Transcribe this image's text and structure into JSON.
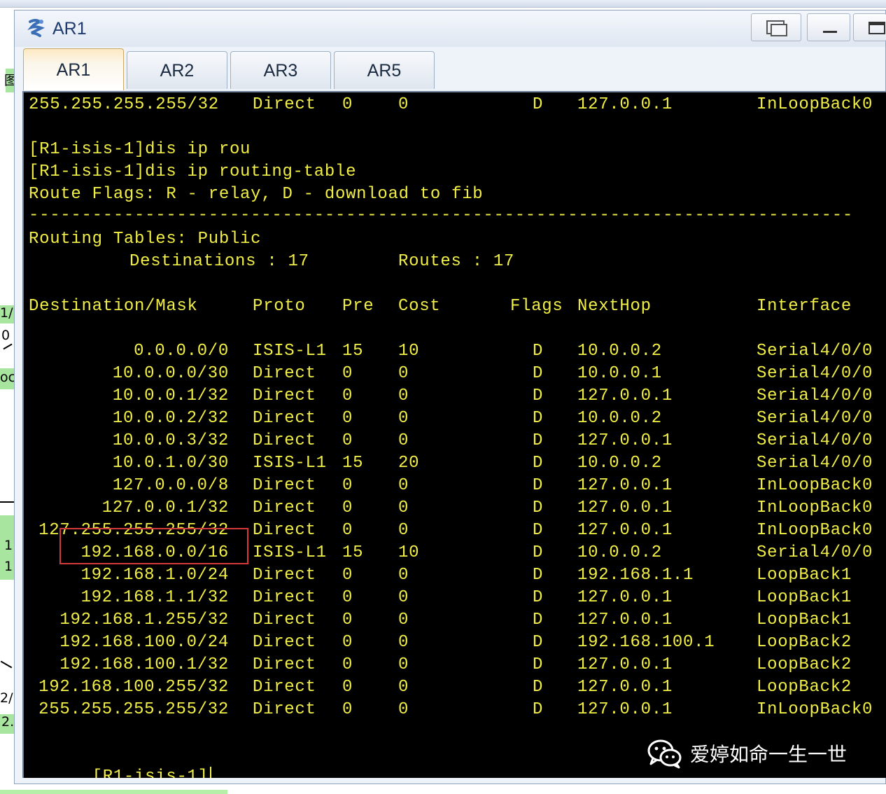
{
  "window": {
    "title": "AR1",
    "tabs": [
      {
        "label": "AR1",
        "active": true
      },
      {
        "label": "AR2",
        "active": false
      },
      {
        "label": "AR3",
        "active": false
      },
      {
        "label": "AR5",
        "active": false
      }
    ]
  },
  "console": {
    "prev_line": {
      "dest": "255.255.255.255/32",
      "proto": "Direct",
      "pre": "0",
      "cost": "0",
      "flags": "D",
      "nexthop": "127.0.0.1",
      "iface": "InLoopBack0"
    },
    "cmd1": "[R1-isis-1]dis ip rou",
    "cmd2": "[R1-isis-1]dis ip routing-table",
    "route_flags": "Route Flags: R - relay, D - download to fib",
    "separator": "------------------------------------------------------------------------------",
    "tables_line": "Routing Tables: Public",
    "destinations_line": "Destinations : 17",
    "routes_line": "Routes : 17",
    "headers": {
      "dest": "Destination/Mask",
      "proto": "Proto",
      "pre": "Pre",
      "cost": "Cost",
      "flags": "Flags",
      "nexthop": "NextHop",
      "iface": "Interface"
    },
    "rows": [
      {
        "dest": "0.0.0.0/0",
        "proto": "ISIS-L1",
        "pre": "15",
        "cost": "10",
        "flags": "D",
        "nexthop": "10.0.0.2",
        "iface": "Serial4/0/0"
      },
      {
        "dest": "10.0.0.0/30",
        "proto": "Direct",
        "pre": "0",
        "cost": "0",
        "flags": "D",
        "nexthop": "10.0.0.1",
        "iface": "Serial4/0/0"
      },
      {
        "dest": "10.0.0.1/32",
        "proto": "Direct",
        "pre": "0",
        "cost": "0",
        "flags": "D",
        "nexthop": "127.0.0.1",
        "iface": "Serial4/0/0"
      },
      {
        "dest": "10.0.0.2/32",
        "proto": "Direct",
        "pre": "0",
        "cost": "0",
        "flags": "D",
        "nexthop": "10.0.0.2",
        "iface": "Serial4/0/0"
      },
      {
        "dest": "10.0.0.3/32",
        "proto": "Direct",
        "pre": "0",
        "cost": "0",
        "flags": "D",
        "nexthop": "127.0.0.1",
        "iface": "Serial4/0/0"
      },
      {
        "dest": "10.0.1.0/30",
        "proto": "ISIS-L1",
        "pre": "15",
        "cost": "20",
        "flags": "D",
        "nexthop": "10.0.0.2",
        "iface": "Serial4/0/0"
      },
      {
        "dest": "127.0.0.0/8",
        "proto": "Direct",
        "pre": "0",
        "cost": "0",
        "flags": "D",
        "nexthop": "127.0.0.1",
        "iface": "InLoopBack0"
      },
      {
        "dest": "127.0.0.1/32",
        "proto": "Direct",
        "pre": "0",
        "cost": "0",
        "flags": "D",
        "nexthop": "127.0.0.1",
        "iface": "InLoopBack0"
      },
      {
        "dest": "127.255.255.255/32",
        "proto": "Direct",
        "pre": "0",
        "cost": "0",
        "flags": "D",
        "nexthop": "127.0.0.1",
        "iface": "InLoopBack0"
      },
      {
        "dest": "192.168.0.0/16",
        "proto": "ISIS-L1",
        "pre": "15",
        "cost": "10",
        "flags": "D",
        "nexthop": "10.0.0.2",
        "iface": "Serial4/0/0"
      },
      {
        "dest": "192.168.1.0/24",
        "proto": "Direct",
        "pre": "0",
        "cost": "0",
        "flags": "D",
        "nexthop": "192.168.1.1",
        "iface": "LoopBack1"
      },
      {
        "dest": "192.168.1.1/32",
        "proto": "Direct",
        "pre": "0",
        "cost": "0",
        "flags": "D",
        "nexthop": "127.0.0.1",
        "iface": "LoopBack1"
      },
      {
        "dest": "192.168.1.255/32",
        "proto": "Direct",
        "pre": "0",
        "cost": "0",
        "flags": "D",
        "nexthop": "127.0.0.1",
        "iface": "LoopBack1"
      },
      {
        "dest": "192.168.100.0/24",
        "proto": "Direct",
        "pre": "0",
        "cost": "0",
        "flags": "D",
        "nexthop": "192.168.100.1",
        "iface": "LoopBack2"
      },
      {
        "dest": "192.168.100.1/32",
        "proto": "Direct",
        "pre": "0",
        "cost": "0",
        "flags": "D",
        "nexthop": "127.0.0.1",
        "iface": "LoopBack2"
      },
      {
        "dest": "192.168.100.255/32",
        "proto": "Direct",
        "pre": "0",
        "cost": "0",
        "flags": "D",
        "nexthop": "127.0.0.1",
        "iface": "LoopBack2"
      },
      {
        "dest": "255.255.255.255/32",
        "proto": "Direct",
        "pre": "0",
        "cost": "0",
        "flags": "D",
        "nexthop": "127.0.0.1",
        "iface": "InLoopBack0"
      }
    ],
    "prompt": "[R1-isis-1]",
    "highlighted_row_index": 9
  },
  "watermark": {
    "text": "爱婷如命一生一世",
    "icon": "wechat-icon"
  },
  "background_fragments": [
    "图",
    "1/",
    "0",
    "oc",
    "1",
    "1",
    "2/",
    "2."
  ],
  "colors": {
    "console_bg": "#000000",
    "console_text": "#f1ee46",
    "highlight": "#d43a3a"
  }
}
